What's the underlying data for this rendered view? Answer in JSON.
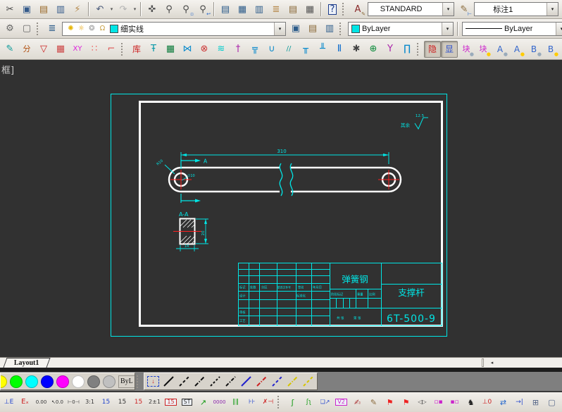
{
  "combos": {
    "text_style": "STANDARD",
    "dim_style": "标注1",
    "layer": "细实线",
    "color": "ByLayer",
    "linetype": "ByLayer",
    "lineweight": "—"
  },
  "tab": {
    "layout": "Layout1"
  },
  "palette": {
    "bylayer": "ByL",
    "colors": [
      {
        "n": "color-yellow-dot",
        "c": "#ffff00"
      },
      {
        "n": "color-green-dot",
        "c": "#00ff00"
      },
      {
        "n": "color-cyan-dot",
        "c": "#00ffff"
      },
      {
        "n": "color-blue-dot",
        "c": "#0000ff"
      },
      {
        "n": "color-magenta-dot",
        "c": "#ff00ff"
      },
      {
        "n": "color-white-dot",
        "c": "#ffffff"
      },
      {
        "n": "color-gray-dot",
        "c": "#808080"
      },
      {
        "n": "color-lightgray-dot",
        "c": "#c0c0c0"
      }
    ]
  },
  "drawing": {
    "clip_label": "框]",
    "dim_length": "310",
    "section_arrow_label": "A",
    "radius_label": "R10",
    "hole_label": "∅10",
    "section_title": "A-A",
    "section_height": "20",
    "section_width": "14",
    "roughness_note": "其余",
    "roughness_value": "12.5",
    "title_block": {
      "material": "弹簧钢",
      "part_name": "支撑杆",
      "drawing_no": "6T-500-9",
      "labels": {
        "mark": "标记",
        "count": "处数",
        "zone": "分区",
        "change_file": "更改文件号",
        "sign": "签名",
        "date": "年月日",
        "design": "设计",
        "standard": "标准化",
        "stage": "阶段标记",
        "weight": "重量",
        "scale": "比例",
        "audit": "审核",
        "craft": "工艺",
        "total": "共 张",
        "page": "第 张"
      }
    }
  },
  "toolbars": {
    "row1": [
      {
        "n": "cut-icon",
        "g": "✂",
        "c": "#444444"
      },
      {
        "n": "copy-icon",
        "g": "▣",
        "c": "#345a8a"
      },
      {
        "n": "paste-icon",
        "g": "▤",
        "c": "#9a6a2a"
      },
      {
        "n": "paste-block-icon",
        "g": "▥",
        "c": "#345a8a"
      },
      {
        "n": "match-properties-icon",
        "g": "⚡",
        "c": "#b5884a"
      },
      {
        "t": "sep"
      },
      {
        "n": "undo-icon",
        "g": "↶",
        "c": "#4a5a7a"
      },
      {
        "n": "undo-caret",
        "t": "caret"
      },
      {
        "n": "redo-icon",
        "g": "↷",
        "c": "#b3b3b3"
      },
      {
        "n": "redo-caret",
        "t": "caret"
      },
      {
        "t": "sep"
      },
      {
        "n": "pan-icon",
        "g": "✜",
        "c": "#555555"
      },
      {
        "n": "zoom-realtime-icon",
        "g": "⚲",
        "c": "#444444"
      },
      {
        "n": "zoom-window-icon",
        "g": "⚲",
        "c": "#444444",
        "sub": "▫",
        "subc": "#2266cc"
      },
      {
        "n": "zoom-previous-icon",
        "g": "⚲",
        "c": "#444444",
        "sub": "↩",
        "subc": "#2266cc"
      },
      {
        "t": "sep"
      },
      {
        "n": "properties-panel-icon",
        "g": "▤",
        "c": "#2d5c8a"
      },
      {
        "n": "tool-palettes-icon",
        "g": "▦",
        "c": "#2d5c8a"
      },
      {
        "n": "panel-small-icon",
        "g": "▥",
        "c": "#2d5c8a"
      },
      {
        "n": "sheetset-icon",
        "g": "≣",
        "c": "#b5884a"
      },
      {
        "n": "markup-set-icon",
        "g": "▤",
        "c": "#8a6a3a"
      },
      {
        "n": "calculator-icon",
        "g": "▦",
        "c": "#555555"
      },
      {
        "t": "sep"
      },
      {
        "n": "help-icon",
        "g": "?",
        "c": "#1a3a8a",
        "boxed": true
      },
      {
        "t": "grip"
      },
      {
        "n": "text-style-icon",
        "g": "A",
        "c": "#8a2a2a",
        "sub": "✎",
        "subc": "#8a6a3a"
      }
    ],
    "row1b": [
      {
        "n": "dim-style-icon",
        "g": "✎",
        "c": "#8a6a3a",
        "sub": "⊢",
        "subc": "#2266cc"
      }
    ],
    "row1c": [
      {
        "n": "table-style-icon",
        "g": "▦",
        "c": "#2d5c8a",
        "sub": "✎",
        "subc": "#8a6a3a"
      }
    ],
    "row2a": [
      {
        "n": "gear-icon",
        "g": "⚙",
        "c": "#666666"
      },
      {
        "n": "viewport-icon",
        "g": "▢",
        "c": "#666666"
      },
      {
        "t": "grip"
      },
      {
        "n": "layer-properties-icon",
        "g": "≣",
        "c": "#2d5c8a"
      }
    ],
    "layer_mini": [
      {
        "n": "layer-bulb-icon",
        "g": "✺",
        "c": "#e6b400"
      },
      {
        "n": "layer-freeze-icon",
        "g": "☼",
        "c": "#e6a000"
      },
      {
        "n": "layer-plot-icon",
        "g": "❂",
        "c": "#9a9a9a"
      },
      {
        "n": "layer-lock-icon",
        "g": "Ω",
        "c": "#caa34a"
      }
    ],
    "row2b": [
      {
        "n": "make-object-layer-current-icon",
        "g": "▣",
        "c": "#2d5c8a"
      },
      {
        "n": "layer-previous-icon",
        "g": "▤",
        "c": "#8a6a3a"
      },
      {
        "n": "layer-states-icon",
        "g": "▥",
        "c": "#2d5c8a"
      },
      {
        "t": "grip"
      }
    ],
    "row3a": [
      {
        "n": "sketch-pen-icon",
        "g": "✎",
        "c": "#0a9a9a"
      },
      {
        "n": "layer-split-icon",
        "g": "分",
        "c": "#b05010",
        "fs": 11
      },
      {
        "n": "filter-delete-icon",
        "g": "▽",
        "c": "#cc2222"
      },
      {
        "n": "block-grid-icon",
        "g": "▦",
        "c": "#cc4444"
      },
      {
        "n": "xy-icon",
        "g": "XY",
        "c": "#dd22dd",
        "fs": 10
      },
      {
        "n": "circles-icon",
        "g": "∷",
        "c": "#ee6666"
      },
      {
        "n": "arc-corner-icon",
        "g": "⌐",
        "c": "#dd5555"
      }
    ],
    "row3b": [
      {
        "n": "library-icon",
        "g": "库",
        "c": "#cc2222",
        "fs": 12
      },
      {
        "n": "valve-icon",
        "g": "Ŧ",
        "c": "#0a9aaa"
      },
      {
        "n": "window-block-icon",
        "g": "▦",
        "c": "#0a7a3a"
      },
      {
        "n": "pipe-joint-icon",
        "g": "⋈",
        "c": "#0a8acc"
      },
      {
        "n": "wheel-icon",
        "g": "⊗",
        "c": "#cc3333"
      },
      {
        "n": "spring-icon",
        "g": "≋",
        "c": "#00cccc"
      },
      {
        "n": "bolt-icon",
        "g": "†",
        "c": "#aa22aa"
      },
      {
        "n": "tee-pipe-icon",
        "g": "╦",
        "c": "#0a8acc"
      },
      {
        "n": "u-pipe-icon",
        "g": "∪",
        "c": "#0a8acc"
      },
      {
        "n": "hatch-lines-icon",
        "g": "//",
        "c": "#0a9a9a",
        "fs": 10
      },
      {
        "n": "tee2-pipe-icon",
        "g": "╥",
        "c": "#0a8acc"
      },
      {
        "n": "tee3-pipe-icon",
        "g": "╨",
        "c": "#0a8acc"
      },
      {
        "n": "coupling-icon",
        "g": "Ⅱ",
        "c": "#0a6acc"
      },
      {
        "n": "sprocket-icon",
        "g": "✱",
        "c": "#444444"
      },
      {
        "n": "target-icon",
        "g": "⊕",
        "c": "#0a8a3a"
      },
      {
        "n": "bolt2-icon",
        "g": "Υ",
        "c": "#aa22aa"
      },
      {
        "n": "bracket-icon",
        "g": "∏",
        "c": "#0a8acc"
      }
    ],
    "row3c": [
      {
        "n": "hide-icon",
        "g": "隐",
        "c": "#cc2222",
        "fs": 12,
        "press": true
      },
      {
        "n": "show-icon",
        "g": "显",
        "c": "#3355cc",
        "fs": 12,
        "press": true
      },
      {
        "n": "block-bulb-off-icon",
        "g": "块",
        "c": "#cc22cc",
        "fs": 11,
        "sub": "●",
        "subc": "#9aabbb"
      },
      {
        "n": "block-bulb-on-icon",
        "g": "块",
        "c": "#cc22cc",
        "fs": 11,
        "sub": "●",
        "subc": "#ffcc00"
      },
      {
        "n": "a-bulb-off-icon",
        "g": "A",
        "c": "#3366cc",
        "fs": 12,
        "sub": "●",
        "subc": "#9aabbb"
      },
      {
        "n": "a-bulb-on-icon",
        "g": "A",
        "c": "#3366cc",
        "fs": 12,
        "sub": "●",
        "subc": "#ffcc00"
      },
      {
        "n": "b-bulb-off-icon",
        "g": "B",
        "c": "#3366cc",
        "fs": 12,
        "sub": "●",
        "subc": "#9aabbb"
      },
      {
        "n": "b-bulb-on-icon",
        "g": "B",
        "c": "#3366cc",
        "fs": 12,
        "sub": "●",
        "subc": "#ffcc00"
      }
    ],
    "linetypes": [
      {
        "n": "linetype-select-icon",
        "t": "sel",
        "g": "↓"
      },
      {
        "n": "linetype-solid-icon",
        "c": "#111111",
        "d": ""
      },
      {
        "n": "linetype-dashed-icon",
        "c": "#111111",
        "d": "4 3"
      },
      {
        "n": "linetype-dashdot-icon",
        "c": "#111111",
        "d": "6 2 1.5 2"
      },
      {
        "n": "linetype-dashed2-icon",
        "c": "#111111",
        "d": "3 2.5"
      },
      {
        "n": "linetype-dashdot2-icon",
        "c": "#111111",
        "d": "5 2 1.5 2"
      },
      {
        "n": "linetype-solid-blue-icon",
        "c": "#2222cc",
        "d": ""
      },
      {
        "n": "linetype-dashdot-red-icon",
        "c": "#cc2222",
        "d": "6 2 1.5 2"
      },
      {
        "n": "linetype-dashed-blue-icon",
        "c": "#2222cc",
        "d": "4 3"
      },
      {
        "n": "linetype-dashdot-yellow-icon",
        "c": "#d6c400",
        "d": "6 2 1.5 2"
      },
      {
        "n": "linetype-dashed-yellow-icon",
        "c": "#d6c400",
        "d": "4 3"
      }
    ],
    "bottom": [
      {
        "n": "ucs-e-icon",
        "g": "⊥E",
        "c": "#2244cc",
        "fs": 9
      },
      {
        "n": "exy-icon",
        "g": "Eₓ",
        "c": "#cc2222",
        "fs": 10
      },
      {
        "n": "precision-icon",
        "g": "0.00",
        "c": "#333333",
        "fs": 7
      },
      {
        "n": "leader-coord-icon",
        "g": "↖0.0",
        "c": "#333333",
        "fs": 7
      },
      {
        "n": "dim-zero-icon",
        "g": "⊢0⊣",
        "c": "#333333",
        "fs": 7
      },
      {
        "n": "dim-ratio-icon",
        "g": "3:1",
        "c": "#333333",
        "fs": 8
      },
      {
        "n": "dim-15-blue-icon",
        "g": "15",
        "c": "#2244cc",
        "fs": 9
      },
      {
        "n": "dim-15-icon",
        "g": "15",
        "c": "#333333",
        "fs": 9
      },
      {
        "n": "dim-15-red-icon",
        "g": "15",
        "c": "#cc2222",
        "fs": 9
      },
      {
        "n": "dim-tolerance-icon",
        "g": "2±1",
        "c": "#333333",
        "fs": 8
      },
      {
        "n": "dim-15-box-icon",
        "g": "15",
        "c": "#cc2222",
        "fs": 8,
        "boxed": true
      },
      {
        "n": "dim-st-icon",
        "g": "ST",
        "c": "#333333",
        "fs": 8,
        "boxed": true
      },
      {
        "n": "leader-arrow-icon",
        "g": "↗",
        "c": "#119911"
      },
      {
        "n": "counter-icon",
        "g": "0000",
        "c": "#8822aa",
        "fs": 7
      },
      {
        "n": "rails-icon",
        "g": "∥∥",
        "c": "#119911",
        "fs": 9
      },
      {
        "n": "dim-rail-icon",
        "g": "⊦⊦",
        "c": "#2244cc",
        "fs": 9
      },
      {
        "n": "dim-x-icon",
        "g": "✗⊣",
        "c": "#cc2222",
        "fs": 9
      },
      {
        "t": "grip"
      },
      {
        "n": "curve-s-icon",
        "g": "ʃ",
        "c": "#119911",
        "fs": 11
      },
      {
        "n": "curve-s2-icon",
        "g": "ʃʅ",
        "c": "#119911",
        "fs": 9
      },
      {
        "n": "block-jump-icon",
        "g": "❏↗",
        "c": "#2244cc",
        "fs": 8
      },
      {
        "n": "v2-icon",
        "g": "V2",
        "c": "#cc22cc",
        "fs": 8,
        "boxed": true
      },
      {
        "n": "brush-ring-icon",
        "g": "✍",
        "c": "#aa3333"
      },
      {
        "n": "brush-bowl-icon",
        "g": "✎",
        "c": "#8a6a3a"
      },
      {
        "n": "flag-icon",
        "g": "⚑",
        "c": "#ee2222"
      },
      {
        "n": "flag2-icon",
        "g": "⚑",
        "c": "#ee2222"
      },
      {
        "n": "mirror-icon",
        "g": "◁▷",
        "c": "#444444",
        "fs": 8
      },
      {
        "n": "block-pink-icon",
        "g": "▫▪",
        "c": "#cc22cc",
        "fs": 9
      },
      {
        "n": "block-pink2-icon",
        "g": "▪▫",
        "c": "#cc22cc",
        "fs": 9
      },
      {
        "n": "animal-icon",
        "g": "♞",
        "c": "#222222"
      },
      {
        "n": "datum-zero-icon",
        "g": "⊥0",
        "c": "#cc2222",
        "fs": 9
      },
      {
        "n": "swap-icon",
        "g": "⇄",
        "c": "#2266cc"
      },
      {
        "n": "wall-arrow-icon",
        "g": "→|",
        "c": "#2244cc",
        "fs": 9
      },
      {
        "n": "copy-pages-icon",
        "g": "⊞",
        "c": "#556688"
      },
      {
        "n": "select-rect-icon",
        "g": "▢",
        "c": "#556688"
      },
      {
        "n": "globe-edit-icon",
        "g": "◍",
        "c": "#2a7a7a"
      }
    ]
  }
}
